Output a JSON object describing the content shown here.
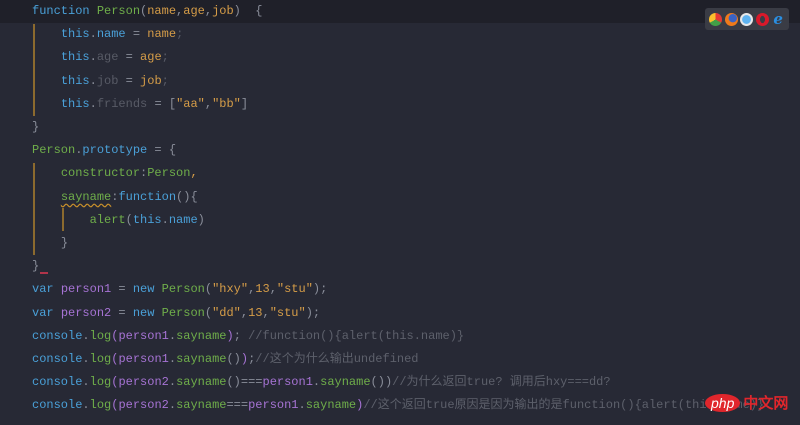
{
  "code_lines": [
    [
      [
        "function",
        "kw"
      ],
      [
        " ",
        ""
      ],
      [
        "Person",
        "fn"
      ],
      [
        "(",
        "op"
      ],
      [
        "name",
        "pa"
      ],
      [
        ",",
        "op"
      ],
      [
        "age",
        "pa"
      ],
      [
        ",",
        "op"
      ],
      [
        "job",
        "pa"
      ],
      [
        ")  {",
        "op"
      ]
    ],
    [
      [
        "    ",
        ""
      ],
      [
        "this",
        "kw"
      ],
      [
        ".",
        "op"
      ],
      [
        "name",
        "pr"
      ],
      [
        " = ",
        "op"
      ],
      [
        "name",
        "pa"
      ],
      [
        ";",
        "un"
      ]
    ],
    [
      [
        "    ",
        ""
      ],
      [
        "this",
        "kw"
      ],
      [
        ".",
        "op"
      ],
      [
        "age",
        "un"
      ],
      [
        " = ",
        "op"
      ],
      [
        "age",
        "pa"
      ],
      [
        ";",
        "un"
      ]
    ],
    [
      [
        "    ",
        ""
      ],
      [
        "this",
        "kw"
      ],
      [
        ".",
        "op"
      ],
      [
        "job",
        "un"
      ],
      [
        " = ",
        "op"
      ],
      [
        "job",
        "pa"
      ],
      [
        ";",
        "un"
      ]
    ],
    [
      [
        "    ",
        ""
      ],
      [
        "this",
        "kw"
      ],
      [
        ".",
        "op"
      ],
      [
        "friends",
        "un"
      ],
      [
        " = [",
        "op"
      ],
      [
        "\"aa\"",
        "st"
      ],
      [
        ",",
        "op"
      ],
      [
        "\"bb\"",
        "st"
      ],
      [
        "]",
        "op"
      ]
    ],
    [
      [
        "}",
        "op"
      ]
    ],
    [
      [
        "Person",
        "fn"
      ],
      [
        ".",
        "op"
      ],
      [
        "prototype",
        "pr"
      ],
      [
        " = {",
        "op"
      ]
    ],
    [
      [
        "    ",
        ""
      ],
      [
        "constructor",
        "fn"
      ],
      [
        ":",
        "op"
      ],
      [
        "Person",
        "fn"
      ],
      [
        ",",
        "pa"
      ]
    ],
    [
      [
        "    ",
        ""
      ],
      [
        "sayname",
        "fn sq"
      ],
      [
        ":",
        "op"
      ],
      [
        "function",
        "kw"
      ],
      [
        "(){",
        "op"
      ]
    ],
    [
      [
        "        ",
        ""
      ],
      [
        "alert",
        "fn"
      ],
      [
        "(",
        "op"
      ],
      [
        "this",
        "kw"
      ],
      [
        ".",
        "op"
      ],
      [
        "name",
        "pr"
      ],
      [
        ")",
        "op"
      ]
    ],
    [
      [
        "    ",
        ""
      ],
      [
        "}",
        "op"
      ]
    ],
    [
      [
        "}",
        "op"
      ]
    ],
    [
      [
        "var",
        "kw"
      ],
      [
        " ",
        ""
      ],
      [
        "person1",
        "va"
      ],
      [
        " = ",
        "op"
      ],
      [
        "new",
        "kw"
      ],
      [
        " ",
        ""
      ],
      [
        "Person",
        "fn"
      ],
      [
        "(",
        "op"
      ],
      [
        "\"hxy\"",
        "st"
      ],
      [
        ",",
        "op"
      ],
      [
        "13",
        "nu"
      ],
      [
        ",",
        "op"
      ],
      [
        "\"stu\"",
        "st"
      ],
      [
        ");",
        "op"
      ]
    ],
    [
      [
        "var",
        "kw"
      ],
      [
        " ",
        ""
      ],
      [
        "person2",
        "va"
      ],
      [
        " = ",
        "op"
      ],
      [
        "new",
        "kw"
      ],
      [
        " ",
        ""
      ],
      [
        "Person",
        "fn"
      ],
      [
        "(",
        "op"
      ],
      [
        "\"dd\"",
        "st"
      ],
      [
        ",",
        "op"
      ],
      [
        "13",
        "nu"
      ],
      [
        ",",
        "op"
      ],
      [
        "\"stu\"",
        "st"
      ],
      [
        ");",
        "op"
      ]
    ],
    [
      [
        "console",
        "kw"
      ],
      [
        ".",
        "op"
      ],
      [
        "log",
        "fn"
      ],
      [
        "(",
        "va"
      ],
      [
        "person1",
        "va"
      ],
      [
        ".",
        "op"
      ],
      [
        "sayname",
        "fn"
      ],
      [
        ")",
        "va"
      ],
      [
        "; ",
        "op"
      ],
      [
        "//function(){alert(this.name)}",
        "cm"
      ]
    ],
    [
      [
        "console",
        "kw"
      ],
      [
        ".",
        "op"
      ],
      [
        "log",
        "fn"
      ],
      [
        "(",
        "va"
      ],
      [
        "person1",
        "va"
      ],
      [
        ".",
        "op"
      ],
      [
        "sayname",
        "fn"
      ],
      [
        "()",
        "op"
      ],
      [
        ")",
        "va"
      ],
      [
        ";",
        "op"
      ],
      [
        "//这个为什么输出undefined",
        "cm"
      ]
    ],
    [
      [
        "console",
        "kw"
      ],
      [
        ".",
        "op"
      ],
      [
        "log",
        "fn"
      ],
      [
        "(",
        "va"
      ],
      [
        "person2",
        "va"
      ],
      [
        ".",
        "op"
      ],
      [
        "sayname",
        "fn"
      ],
      [
        "()===",
        "op"
      ],
      [
        "person1",
        "va"
      ],
      [
        ".",
        "op"
      ],
      [
        "sayname",
        "fn"
      ],
      [
        "())",
        "op"
      ],
      [
        "//为什么返回true? 调用后hxy===dd?",
        "cm"
      ]
    ],
    [
      [
        "console",
        "kw"
      ],
      [
        ".",
        "op"
      ],
      [
        "log",
        "fn"
      ],
      [
        "(",
        "va"
      ],
      [
        "person2",
        "va"
      ],
      [
        ".",
        "op"
      ],
      [
        "sayname",
        "fn"
      ],
      [
        "===",
        "op"
      ],
      [
        "person1",
        "va"
      ],
      [
        ".",
        "op"
      ],
      [
        "sayname",
        "fn"
      ],
      [
        ")",
        "va"
      ],
      [
        "//这个返回true原因是因为输出的是function(){alert(this.name)}",
        "cm"
      ]
    ]
  ],
  "browser_icons": [
    "chrome-icon",
    "firefox-icon",
    "safari-icon",
    "opera-icon",
    "ie-icon"
  ],
  "watermark": {
    "php": "php",
    "cn": "中文网"
  }
}
